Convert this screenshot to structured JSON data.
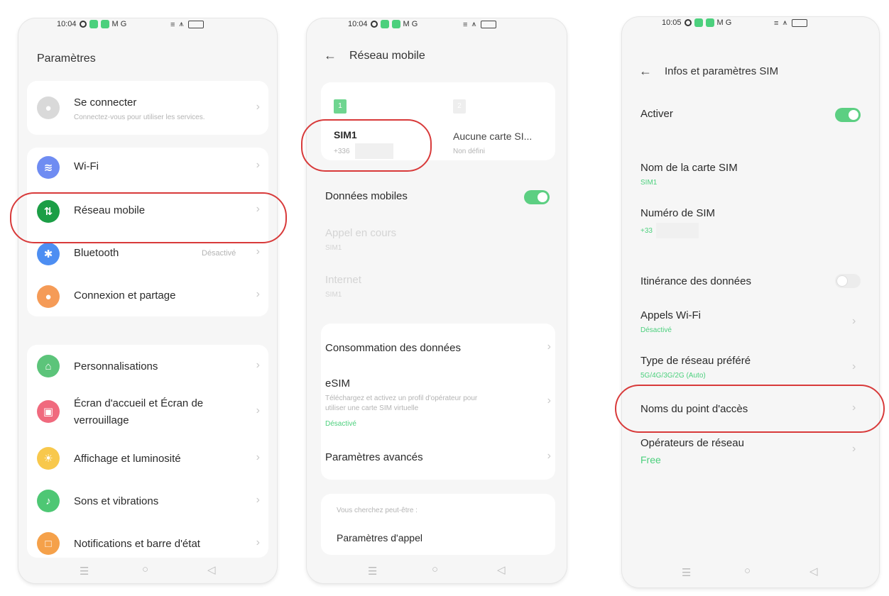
{
  "screen1": {
    "status_time": "10:04",
    "title": "Paramètres",
    "items": [
      {
        "label": "Se connecter",
        "sub": "Connectez-vous pour utiliser les services."
      },
      {
        "label": "Wi-Fi"
      },
      {
        "label": "Réseau mobile"
      },
      {
        "label": "Bluetooth",
        "value": "Désactivé"
      },
      {
        "label": "Connexion et partage"
      },
      {
        "label": "Personnalisations"
      },
      {
        "label": "Écran d'accueil et Écran de",
        "label2": "verrouillage"
      },
      {
        "label": "Affichage et luminosité"
      },
      {
        "label": "Sons et vibrations"
      },
      {
        "label": "Notifications et barre d'état"
      }
    ]
  },
  "screen2": {
    "status_time": "10:04",
    "title": "Réseau mobile",
    "sim1": {
      "slot": "1",
      "name": "SIM1",
      "number": "+336"
    },
    "sim2": {
      "slot": "2",
      "name": "Aucune carte SI...",
      "status": "Non défini"
    },
    "mobile_data": "Données mobiles",
    "call_in_progress": "Appel en cours",
    "call_sim": "SIM1",
    "internet": "Internet",
    "internet_sim": "SIM1",
    "data_usage": "Consommation des données",
    "esim": "eSIM",
    "esim_desc1": "Téléchargez et activez un profil d'opérateur pour",
    "esim_desc2": "utiliser une carte SIM virtuelle",
    "esim_status": "Désactivé",
    "advanced": "Paramètres avancés",
    "suggest": "Vous cherchez peut-être :",
    "call_settings": "Paramètres d'appel"
  },
  "screen3": {
    "status_time": "10:05",
    "title": "Infos et paramètres SIM",
    "activate": "Activer",
    "sim_name_label": "Nom de la carte SIM",
    "sim_name_value": "SIM1",
    "sim_number_label": "Numéro de SIM",
    "sim_number_value": "+33",
    "roaming": "Itinérance des données",
    "wifi_calls": "Appels Wi-Fi",
    "wifi_calls_status": "Désactivé",
    "network_type": "Type de réseau préféré",
    "network_type_value": "5G/4G/3G/2G (Auto)",
    "apn": "Noms du point d'accès",
    "operators": "Opérateurs de réseau",
    "operator_value": "Free"
  },
  "status_icons": {
    "left": "M G",
    "right": "N ."
  },
  "colors": {
    "accent_green": "#4cd07d",
    "highlight_red": "#d83a3a"
  },
  "icons": [
    "person-icon",
    "wifi-icon",
    "mobile-data-icon",
    "bluetooth-icon",
    "share-icon",
    "person-pin-icon",
    "wallpaper-icon",
    "sun-icon",
    "bell-icon",
    "notification-icon",
    "back-arrow-icon",
    "chevron-right-icon"
  ]
}
